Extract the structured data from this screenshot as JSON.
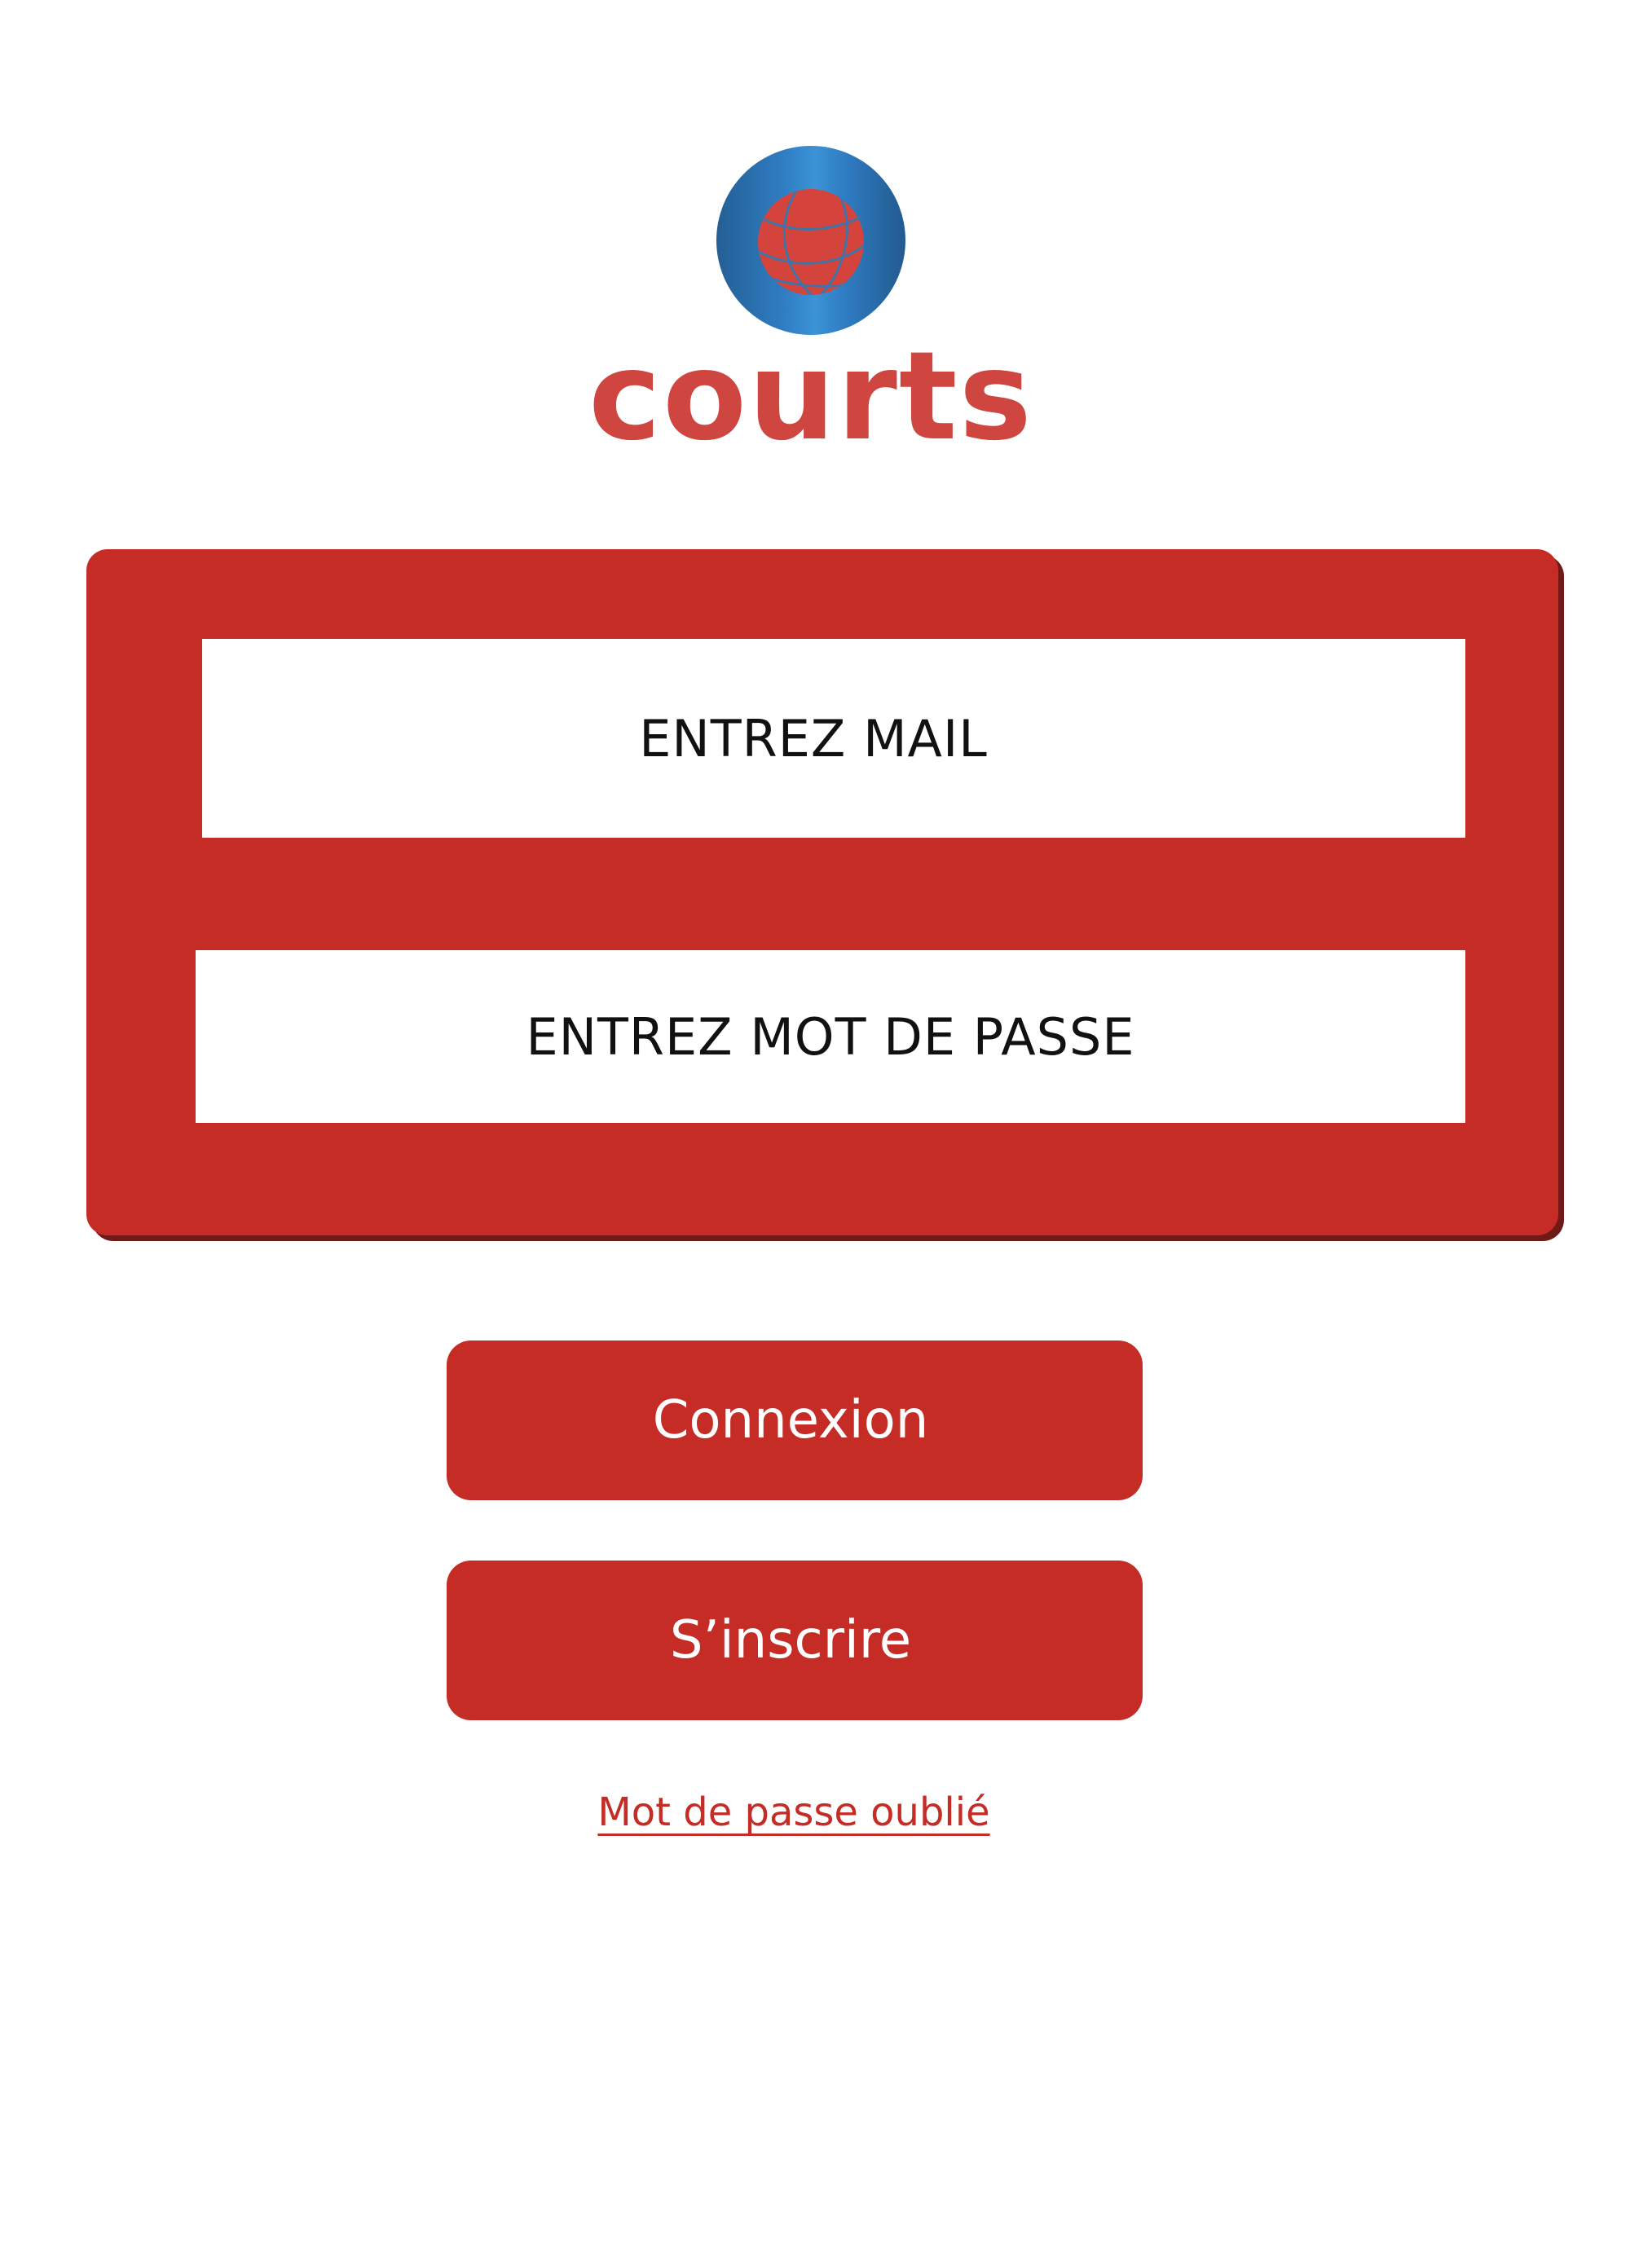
{
  "brand": {
    "name": "courts",
    "logo_icon": "basketball-icon",
    "colors": {
      "brand_red": "#cf4540",
      "accent_red": "#c42c25",
      "logo_blue": "#2f7cc2"
    }
  },
  "login_form": {
    "email_placeholder": "ENTREZ MAIL",
    "password_placeholder": "ENTREZ MOT DE PASSE"
  },
  "actions": {
    "login_label": "Connexion",
    "signup_label": "S’inscrire",
    "forgot_password_label": "Mot de passe oublié"
  }
}
